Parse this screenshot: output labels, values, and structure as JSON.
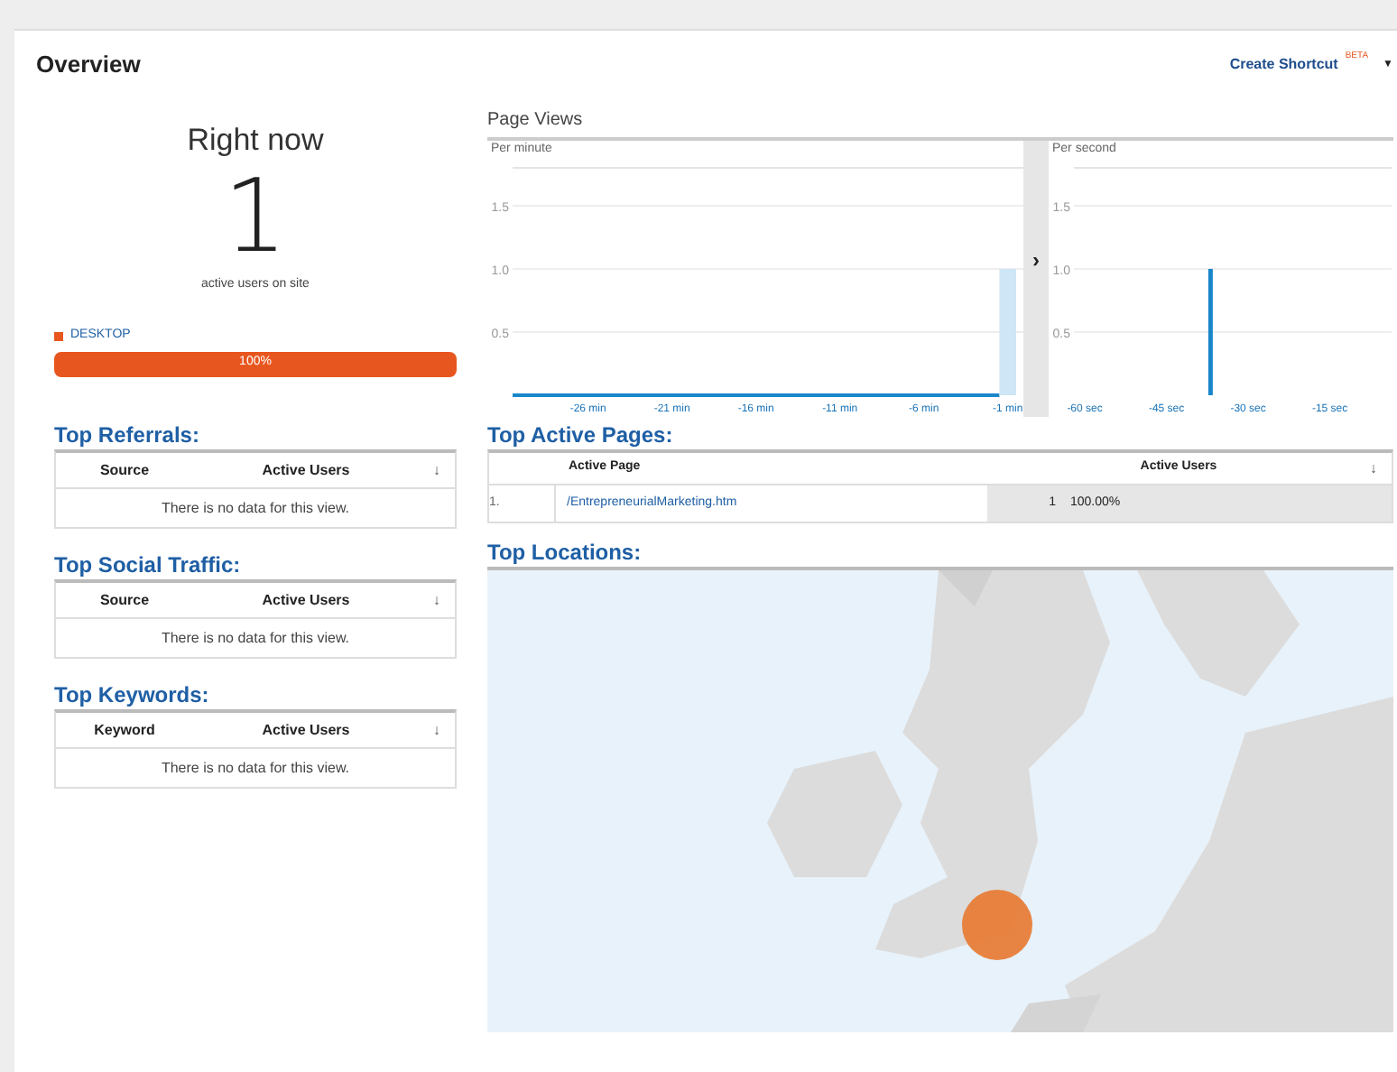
{
  "header": {
    "title": "Overview",
    "shortcut": "Create Shortcut",
    "badge": "BETA",
    "caret": "▼"
  },
  "right_now": {
    "title": "Right now",
    "count": "1",
    "caption": "active users on site",
    "segments": [
      {
        "label": "DESKTOP",
        "color": "#e8561f",
        "level": 1,
        "reading": "100%"
      }
    ]
  },
  "page_views": {
    "title": "Page Views",
    "collapse": "›",
    "per_minute": {
      "title": "Per minute",
      "chart_data": {
        "type": "bar",
        "grid": true,
        "x": [
          -1
        ],
        "values": [
          1
        ],
        "xlim": [
          -30.5,
          -0.5
        ],
        "ylim": [
          0,
          1.8
        ],
        "yticks": [
          {
            "value": 0.5,
            "label": "0.5"
          },
          {
            "value": 1,
            "label": "1.0"
          },
          {
            "value": 1.5,
            "label": "1.5"
          }
        ],
        "xticks": [
          {
            "value": -26,
            "label": "-26 min"
          },
          {
            "value": -21,
            "label": "-21 min"
          },
          {
            "value": -16,
            "label": "-16 min"
          },
          {
            "value": -11,
            "label": "-11 min"
          },
          {
            "value": -6,
            "label": "-6 min"
          },
          {
            "value": -1,
            "label": "-1 min"
          }
        ]
      }
    },
    "per_second": {
      "title": "Per second",
      "chart_data": {
        "type": "bar",
        "grid": true,
        "x": [
          -37
        ],
        "values": [
          1
        ],
        "xlim": [
          -62,
          -5
        ],
        "ylim": [
          0,
          1.8
        ],
        "yticks": [
          {
            "value": 0.5,
            "label": "0.5"
          },
          {
            "value": 1,
            "label": "1.0"
          },
          {
            "value": 1.5,
            "label": "1.5"
          }
        ],
        "xticks": [
          {
            "value": -60,
            "label": "-60 sec"
          },
          {
            "value": -45,
            "label": "-45 sec"
          },
          {
            "value": -30,
            "label": "-30 sec"
          },
          {
            "value": -15,
            "label": "-15 sec"
          }
        ]
      }
    }
  },
  "left_tables": [
    {
      "title": "Top Referrals:",
      "columns": [
        "Source",
        "Active Users"
      ],
      "sort": "↓",
      "empty": "There is no data for this view."
    },
    {
      "title": "Top Social Traffic:",
      "columns": [
        "Source",
        "Active Users"
      ],
      "sort": "↓",
      "empty": "There is no data for this view."
    },
    {
      "title": "Top Keywords:",
      "columns": [
        "Keyword",
        "Active Users"
      ],
      "sort": "↓",
      "empty": "There is no data for this view."
    }
  ],
  "top_active_pages": {
    "title": "Top Active Pages:",
    "columns": [
      "Active Page",
      "Active Users"
    ],
    "sort": "↓",
    "rows": [
      {
        "index": "1.",
        "page": "/EntrepreneurialMarketing.htm",
        "users": "1",
        "percent": "100.00%"
      }
    ]
  },
  "top_locations": {
    "title": "Top Locations:"
  }
}
